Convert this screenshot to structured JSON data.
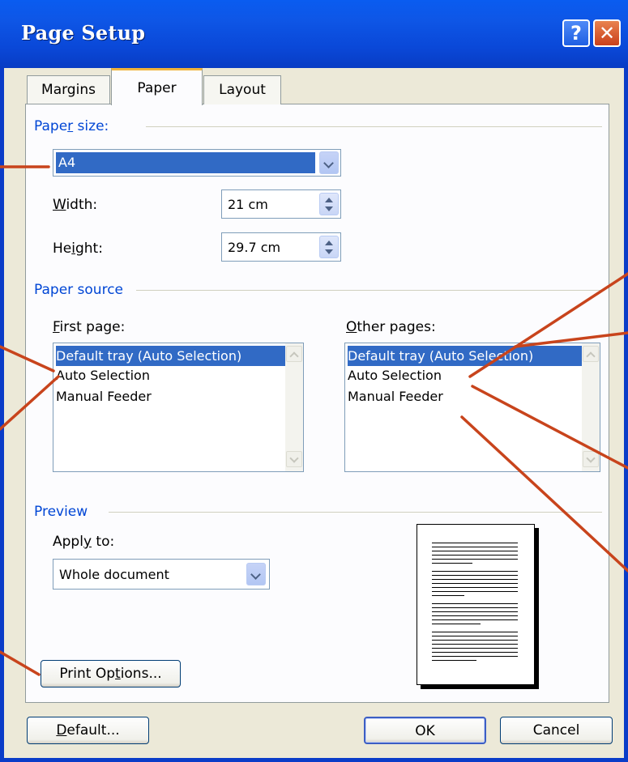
{
  "window": {
    "title": "Page Setup",
    "help_glyph": "?",
    "close_glyph": "✕"
  },
  "tabs": [
    {
      "label": "Margins",
      "active": false
    },
    {
      "label": "Paper",
      "active": true
    },
    {
      "label": "Layout",
      "active": false
    }
  ],
  "paper_size": {
    "group_label_pre": "Pape",
    "group_label_accel": "r",
    "group_label_post": " size:",
    "selected": "A4",
    "width_label_accel": "W",
    "width_label_post": "idth:",
    "width_value": "21 cm",
    "height_label_pre": "He",
    "height_label_accel": "i",
    "height_label_post": "ght:",
    "height_value": "29.7 cm"
  },
  "paper_source": {
    "group_label": "Paper source",
    "first_label_accel": "F",
    "first_label_post": "irst page:",
    "other_label_accel": "O",
    "other_label_post": "ther pages:",
    "first_items": [
      "Default tray (Auto Selection)",
      "Auto Selection",
      "Manual Feeder"
    ],
    "other_items": [
      "Default tray (Auto Selection)",
      "Auto Selection",
      "Manual Feeder"
    ],
    "selected_index": 0
  },
  "preview": {
    "group_label": "Preview",
    "apply_label_pre": "Appl",
    "apply_label_accel": "y",
    "apply_label_post": " to:",
    "apply_value": "Whole document"
  },
  "buttons": {
    "print_options_pre": "Print Op",
    "print_options_accel": "t",
    "print_options_post": "ions...",
    "default_accel": "D",
    "default_post": "efault...",
    "ok": "OK",
    "cancel": "Cancel"
  },
  "colors": {
    "accent": "#0046d5",
    "selection": "#316ac5",
    "callout": "#c8441c",
    "titlebar": "#0a5cf0"
  }
}
